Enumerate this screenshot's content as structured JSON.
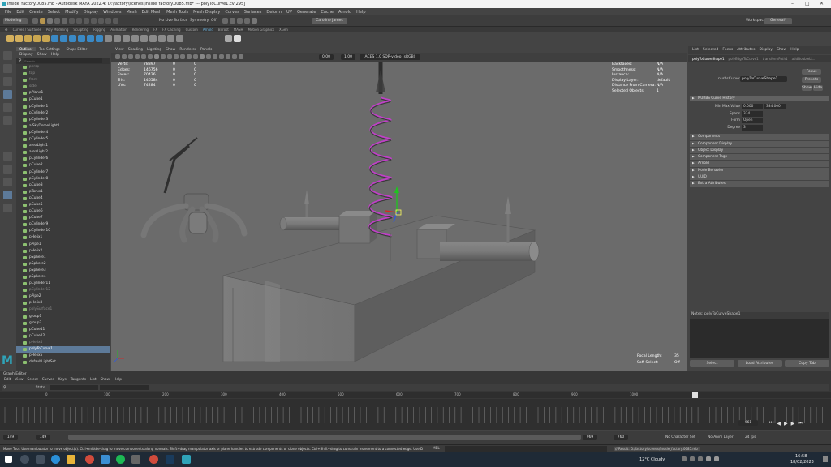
{
  "window": {
    "title": "inside_factory.0085.mb - Autodesk MAYA 2022.4: D:\\factory\\scenes\\inside_factory.0085.mb* --- polyToCurve1.cv[295]"
  },
  "menus": [
    "File",
    "Edit",
    "Create",
    "Select",
    "Modify",
    "Display",
    "Windows",
    "Mesh",
    "Edit Mesh",
    "Mesh Tools",
    "Mesh Display",
    "Curves",
    "Surfaces",
    "Deform",
    "UV",
    "Generate",
    "Cache",
    "Arnold",
    "Help"
  ],
  "status": {
    "mode": "Modeling",
    "live_surface": "No Live Surface",
    "symmetry": "Symmetry: Off",
    "workspace_label": "Workspace:",
    "workspace_value": "General*",
    "user": "Caroline James"
  },
  "shelf_tabs": [
    "Curves / Surfaces",
    "Poly Modeling",
    "Sculpting",
    "Rigging",
    "Animation",
    "Rendering",
    "FX",
    "FX Caching",
    "Custom",
    "Arnold",
    "Bifrost",
    "MASH",
    "Motion Graphics",
    "XGen"
  ],
  "shelf_tabs_active": "Arnold",
  "outliner": {
    "tabs": [
      "Outliner",
      "Tool Settings",
      "Shape Editor"
    ],
    "menu": [
      "Display",
      "Show",
      "Help"
    ],
    "search_placeholder": "Search...",
    "items": [
      {
        "label": "persp",
        "dim": true
      },
      {
        "label": "top",
        "dim": true
      },
      {
        "label": "front",
        "dim": true
      },
      {
        "label": "side",
        "dim": true
      },
      {
        "label": "pPlane1",
        "dim": false
      },
      {
        "label": "pCube1",
        "dim": false
      },
      {
        "label": "pCylinder1",
        "dim": false
      },
      {
        "label": "pCylinder2",
        "dim": false
      },
      {
        "label": "pCylinder3",
        "dim": false
      },
      {
        "label": "aiSkyDomeLight1",
        "dim": false
      },
      {
        "label": "pCylinder4",
        "dim": false
      },
      {
        "label": "pCylinder5",
        "dim": false
      },
      {
        "label": "areaLight1",
        "dim": false
      },
      {
        "label": "areaLight2",
        "dim": false
      },
      {
        "label": "pCylinder6",
        "dim": false
      },
      {
        "label": "pCube2",
        "dim": false
      },
      {
        "label": "pCylinder7",
        "dim": false
      },
      {
        "label": "pCylinder8",
        "dim": false
      },
      {
        "label": "pCube3",
        "dim": false
      },
      {
        "label": "pTorus1",
        "dim": false
      },
      {
        "label": "pCube4",
        "dim": false
      },
      {
        "label": "pCube5",
        "dim": false
      },
      {
        "label": "pCube6",
        "dim": false
      },
      {
        "label": "pCube7",
        "dim": false
      },
      {
        "label": "pCylinder9",
        "dim": false
      },
      {
        "label": "pCylinder10",
        "dim": false
      },
      {
        "label": "pHelix1",
        "dim": false
      },
      {
        "label": "pPipe1",
        "dim": false
      },
      {
        "label": "pHelix2",
        "dim": false
      },
      {
        "label": "pSphere1",
        "dim": false
      },
      {
        "label": "pSphere2",
        "dim": false
      },
      {
        "label": "pSphere3",
        "dim": false
      },
      {
        "label": "pSphere4",
        "dim": false
      },
      {
        "label": "pCylinder11",
        "dim": false
      },
      {
        "label": "pCylinder12",
        "dim": true
      },
      {
        "label": "pPipe2",
        "dim": false
      },
      {
        "label": "pHelix3",
        "dim": false
      },
      {
        "label": "polySurface1",
        "dim": true
      },
      {
        "label": "group1",
        "dim": false
      },
      {
        "label": "group2",
        "dim": false
      },
      {
        "label": "pCube11",
        "dim": false
      },
      {
        "label": "pCube12",
        "dim": false
      },
      {
        "label": "pHelix4",
        "dim": true
      },
      {
        "label": "polyToCurve1",
        "dim": false,
        "selected": true
      },
      {
        "label": "pHelix5",
        "dim": false
      },
      {
        "label": "defaultLightSet",
        "dim": false
      }
    ]
  },
  "viewport": {
    "menu": [
      "View",
      "Shading",
      "Lighting",
      "Show",
      "Renderer",
      "Panels"
    ],
    "field1": "0.00",
    "field2": "1.00",
    "colorspace": "ACES 1.0 SDR-video (sRGB)",
    "hud_left": [
      {
        "label": "Verts:",
        "a": "78397",
        "b": "0",
        "c": "0"
      },
      {
        "label": "Edges:",
        "a": "146756",
        "b": "0",
        "c": "0"
      },
      {
        "label": "Faces:",
        "a": "70426",
        "b": "0",
        "c": "0"
      },
      {
        "label": "Tris:",
        "a": "146584",
        "b": "0",
        "c": "0"
      },
      {
        "label": "UVs:",
        "a": "74284",
        "b": "0",
        "c": "0"
      }
    ],
    "hud_right": [
      {
        "label": "Backfaces:",
        "v": "N/A"
      },
      {
        "label": "Smoothness:",
        "v": "N/A"
      },
      {
        "label": "Instance:",
        "v": "N/A"
      },
      {
        "label": "Display Layer:",
        "v": "default"
      },
      {
        "label": "Distance From Camera:",
        "v": "N/A"
      },
      {
        "label": "Selected Objects:",
        "v": "1"
      }
    ],
    "focal_label": "Focal Length:",
    "focal_value": "35",
    "soft_label": "Soft Select:",
    "soft_value": "Off"
  },
  "attr": {
    "menu": [
      "List",
      "Selected",
      "Focus",
      "Attributes",
      "Display",
      "Show",
      "Help"
    ],
    "node_tabs": [
      "polyToCurveShape1",
      "polyEdgeToCurve1",
      "transformPath1",
      "addDoubleLi..."
    ],
    "node_label": "nurbsCurve:",
    "node_value": "polyToCurveShape1",
    "focus": "Focus",
    "presets": "Presets",
    "show": "Show",
    "hide": "Hide",
    "history_title": "NURBS Curve History",
    "fields": [
      {
        "label": "Min Max Value",
        "v1": "0.000",
        "v2": "334.000"
      },
      {
        "label": "Spans",
        "v1": "334"
      },
      {
        "label": "Form",
        "v1": "Open"
      },
      {
        "label": "Degree",
        "v1": "3"
      }
    ],
    "sections": [
      "Components",
      "Component Display",
      "Object Display",
      "Component Tags",
      "Arnold",
      "Node Behavior",
      "UUID",
      "Extra Attributes"
    ],
    "notes": "Notes:  polyToCurveShape1",
    "buttons": [
      "Select",
      "Load Attributes",
      "Copy Tab"
    ]
  },
  "graph": {
    "title": "Graph Editor",
    "menu": [
      "Edit",
      "View",
      "Select",
      "Curves",
      "Keys",
      "Tangents",
      "List",
      "Show",
      "Help"
    ],
    "stats_label": "Stats",
    "top_ticks": [
      "0",
      "100",
      "200",
      "300",
      "400",
      "500",
      "600",
      "700",
      "800",
      "900",
      "1000"
    ],
    "playhead": "961"
  },
  "range": {
    "start": "149",
    "start2": "149",
    "end": "969",
    "end2": "760",
    "current": "961",
    "char_set": "No Character Set",
    "anim_layer": "No Anim Layer",
    "fps": "24 fps"
  },
  "cmd": {
    "help": "Move Tool: Use manipulator to move object(s). Ctrl+middle-drag to move components along normals. Shift+drag manipulator axis or plane handles to extrude components or clone objects. Ctrl+Shift+drag to constrain movement to a connected edge. Use D or INSERT to change the pi",
    "mel": "MEL",
    "result": "// Result: D:/factory/scenes/inside_factory.0085.mb"
  },
  "taskbar": {
    "weather": "12°C  Cloudy",
    "time": "16:58",
    "date": "18/02/2023"
  },
  "colors": {
    "curve": "#c040c8",
    "accent": "#5d7a99",
    "maya_logo": "#2fa3b8"
  }
}
